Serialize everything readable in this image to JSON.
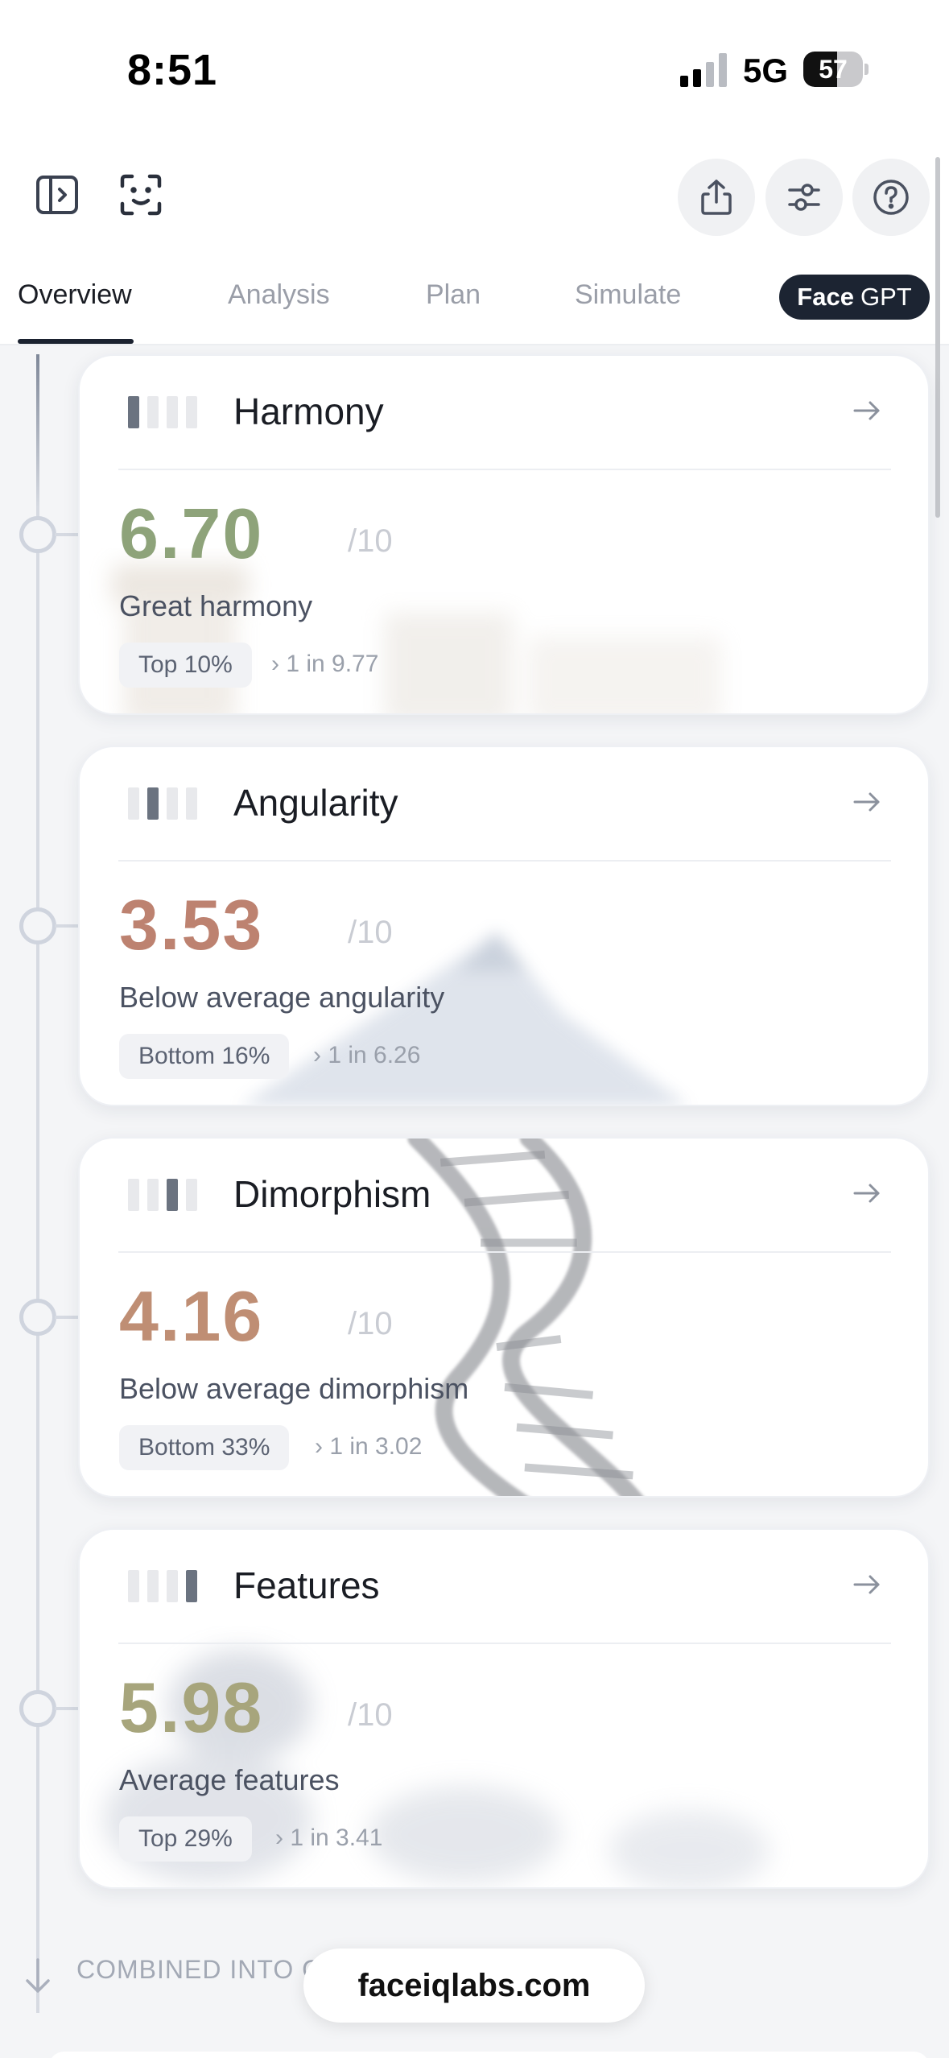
{
  "status_bar": {
    "time": "8:51",
    "network": "5G",
    "battery_level": "57",
    "battery_fraction": 0.57
  },
  "toolbar": {
    "left_icons": [
      "sidebar-toggle-icon",
      "face-scan-icon"
    ],
    "right_buttons": [
      "share-icon",
      "sliders-icon",
      "help-icon"
    ]
  },
  "tabs": {
    "items": [
      "Overview",
      "Analysis",
      "Plan",
      "Simulate"
    ],
    "active": "Overview",
    "facegpt_bold": "Face",
    "facegpt_rest": "GPT"
  },
  "cards": [
    {
      "title": "Harmony",
      "score": "6.70",
      "max": "/10",
      "description": "Great harmony",
      "rank": "Top 10%",
      "odds": "› 1 in 9.77",
      "score_color": "#8ea37a",
      "active_bar": 0
    },
    {
      "title": "Angularity",
      "score": "3.53",
      "max": "/10",
      "description": "Below average angularity",
      "rank": "Bottom 16%",
      "odds": "› 1 in 6.26",
      "score_color": "#bd8270",
      "active_bar": 1
    },
    {
      "title": "Dimorphism",
      "score": "4.16",
      "max": "/10",
      "description": "Below average dimorphism",
      "rank": "Bottom 33%",
      "odds": "› 1 in 3.02",
      "score_color": "#bf8e74",
      "active_bar": 2
    },
    {
      "title": "Features",
      "score": "5.98",
      "max": "/10",
      "description": "Average features",
      "rank": "Top 29%",
      "odds": "› 1 in 3.41",
      "score_color": "#a7a57c",
      "active_bar": 3
    }
  ],
  "footer": {
    "combined_text": "COMBINED INTO C",
    "url": "faceiqlabs.com"
  }
}
